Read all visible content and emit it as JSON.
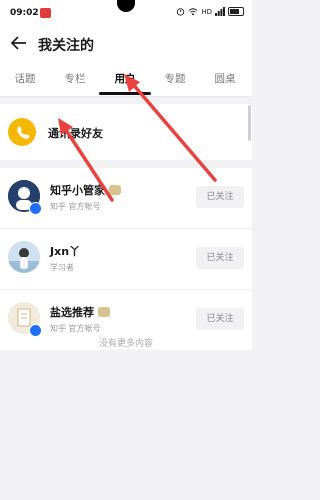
{
  "status_bar": {
    "time": "09:02",
    "network_label": "HD",
    "icons": [
      "app-notification-icon",
      "alarm-icon",
      "wifi-icon",
      "signal-icon",
      "battery-icon"
    ]
  },
  "header": {
    "title": "我关注的",
    "back_icon": "arrow-left-icon"
  },
  "tabs": [
    {
      "label": "话题",
      "active": false
    },
    {
      "label": "专栏",
      "active": false
    },
    {
      "label": "用户",
      "active": true
    },
    {
      "label": "专题",
      "active": false
    },
    {
      "label": "圆桌",
      "active": false
    }
  ],
  "contacts": {
    "label": "通讯录好友",
    "icon": "phone-icon",
    "accent": "#f5b800"
  },
  "users": [
    {
      "name": "知乎小管家",
      "subtitle": "知乎 官方帐号",
      "follow_label": "已关注",
      "verified": true
    },
    {
      "name": "Jxn丫",
      "subtitle": "学习者",
      "follow_label": "已关注",
      "verified": false
    },
    {
      "name": "盐选推荐",
      "subtitle": "知乎 官方帐号",
      "follow_label": "已关注",
      "verified": true
    }
  ],
  "footer": {
    "no_more": "没有更多内容"
  },
  "colors": {
    "annotation_arrow": "#e8413e",
    "verified": "#1e6fff"
  }
}
